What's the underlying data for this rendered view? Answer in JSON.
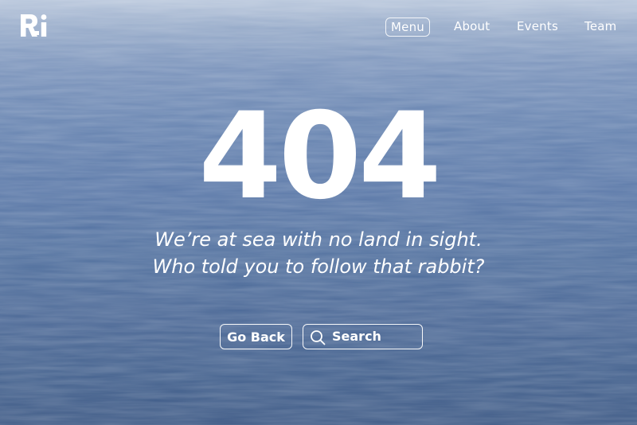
{
  "brand": {
    "logo_text": "Ri"
  },
  "nav": {
    "items": [
      {
        "label": "Menu",
        "active": true
      },
      {
        "label": "About"
      },
      {
        "label": "Events"
      },
      {
        "label": "Team"
      }
    ]
  },
  "error": {
    "code": "404",
    "line1": "We’re at sea with no land in sight.",
    "line2": "Who told you to follow that rabbit?"
  },
  "actions": {
    "back_label": "Go Back",
    "search_label": "Search",
    "search_icon": "search-icon"
  },
  "colors": {
    "text": "#ffffff",
    "sea_dark": "#3e5a86",
    "sea_light": "#b9c7dc"
  }
}
